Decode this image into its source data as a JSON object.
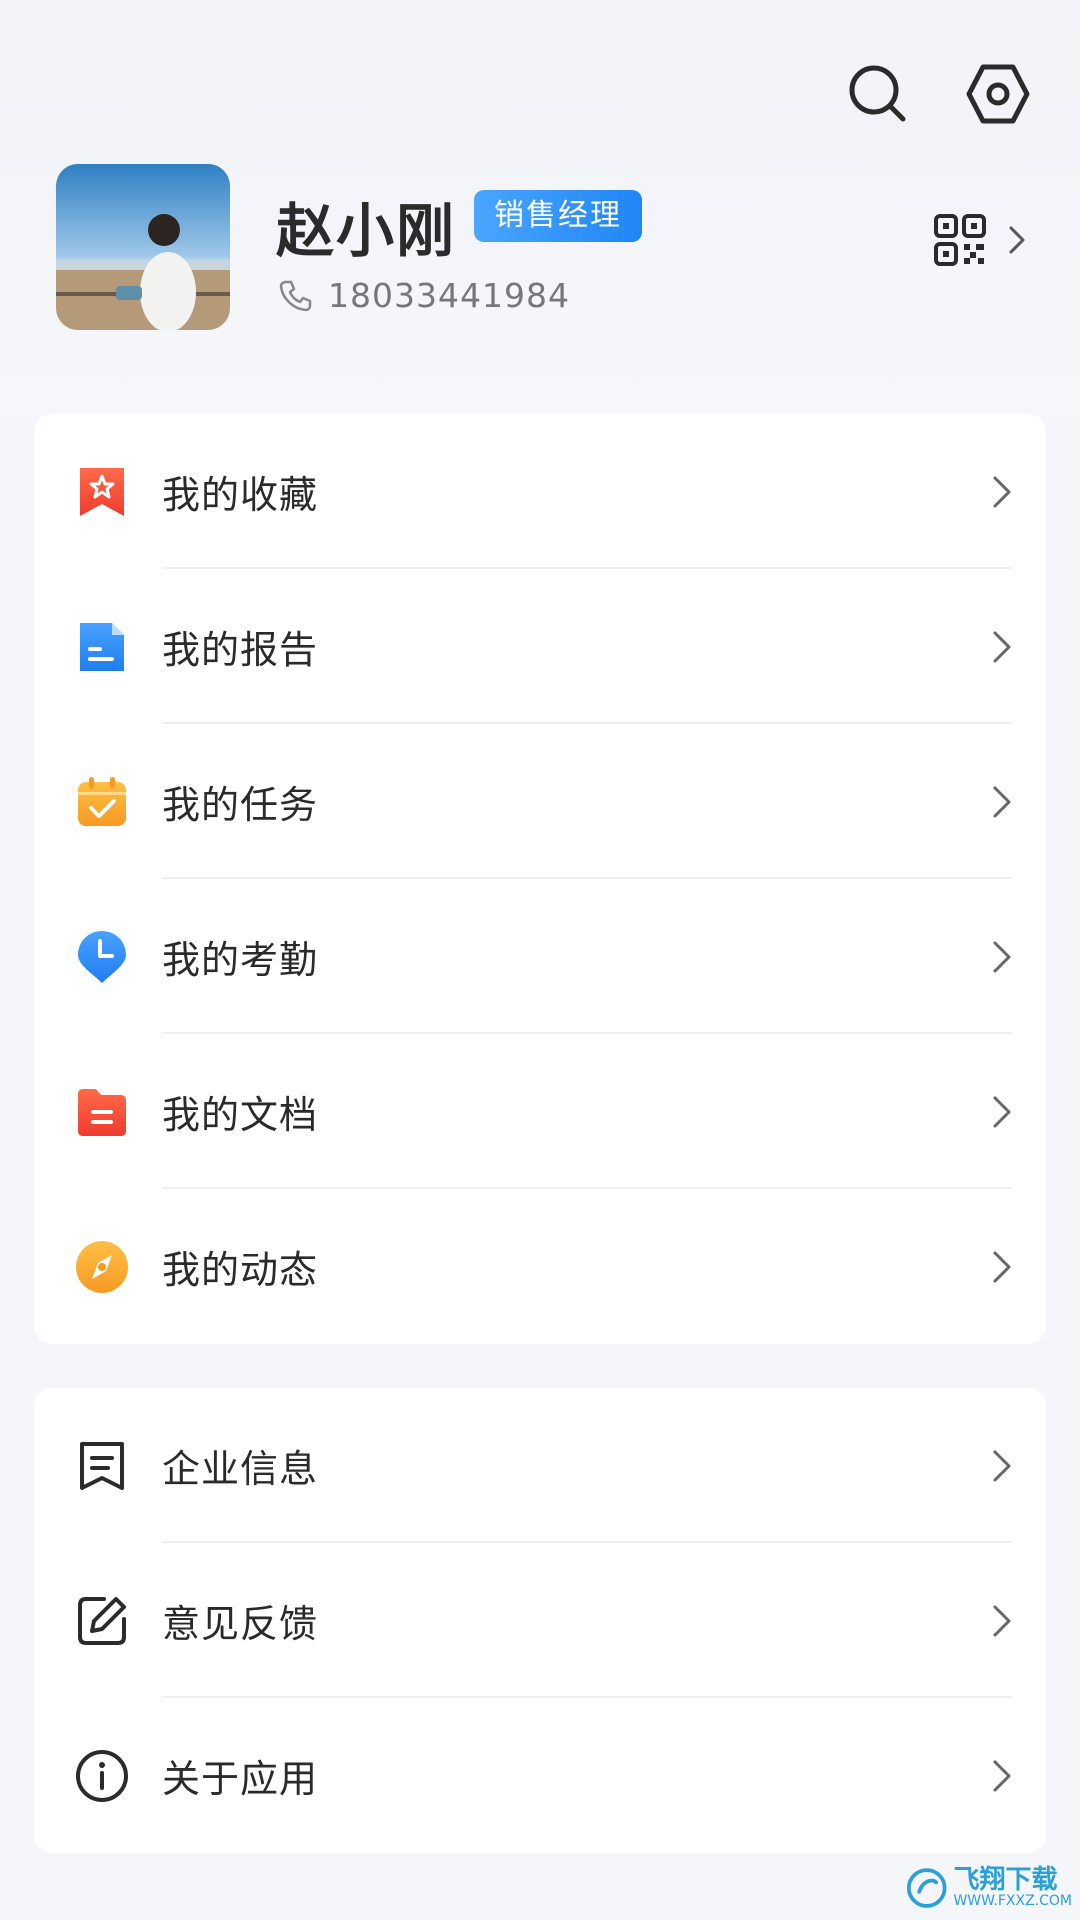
{
  "profile": {
    "name": "赵小刚",
    "role_badge": "销售经理",
    "phone": "18033441984"
  },
  "icons": {
    "search": "search-icon",
    "settings": "settings-hexagon-icon",
    "qr": "qr-code-icon",
    "phone": "phone-icon",
    "chevron": "chevron-right-icon"
  },
  "menu_primary": [
    {
      "label": "我的收藏",
      "icon": "bookmark-star-icon",
      "color": "#f24e3c"
    },
    {
      "label": "我的报告",
      "icon": "document-icon",
      "color": "#2f8cf5"
    },
    {
      "label": "我的任务",
      "icon": "calendar-check-icon",
      "color": "#f8a531"
    },
    {
      "label": "我的考勤",
      "icon": "location-clock-icon",
      "color": "#2f8cf5"
    },
    {
      "label": "我的文档",
      "icon": "folder-icon",
      "color": "#f24e3c"
    },
    {
      "label": "我的动态",
      "icon": "compass-icon",
      "color": "#f8a531"
    }
  ],
  "menu_secondary": [
    {
      "label": "企业信息",
      "icon": "enterprise-info-icon"
    },
    {
      "label": "意见反馈",
      "icon": "feedback-edit-icon"
    },
    {
      "label": "关于应用",
      "icon": "info-icon"
    }
  ],
  "watermark": {
    "text": "飞翔下载",
    "sub": "WWW.FXXZ.COM"
  }
}
